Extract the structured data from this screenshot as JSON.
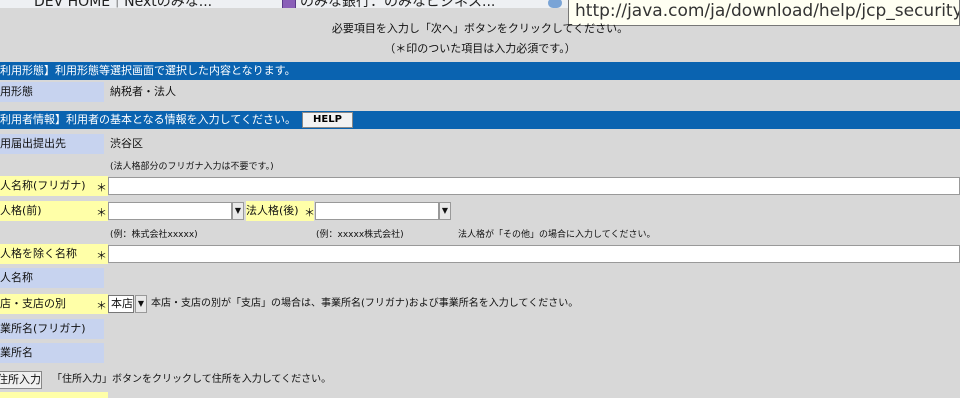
{
  "browser": {
    "tab_1": "DEV HOME｜Nextのみな...",
    "tab_2": "のみな銀行：のみなビジネス...",
    "url_tooltip": "http://java.com/ja/download/help/jcp_security.xml"
  },
  "notice": {
    "line1": "必要項目を入力し「次へ」ボタンをクリックしてください。",
    "line2": "（＊印のついた項目は入力必須です。）"
  },
  "section_usage": {
    "header": "利用形態】利用形態等選択画面で選択した内容となります。",
    "type_label": "用形態",
    "type_value": "納税者・法人"
  },
  "section_user": {
    "header": "利用者情報】利用者の基本となる情報を入力してください。",
    "help_label": "HELP",
    "office_label": "用届出提出先",
    "office_value": "渋谷区",
    "furigana_note": "(法人格部分のフリガナ入力は不要です。)",
    "corp_name_kana_label": "人名称(フリガナ)",
    "corp_type_front_label": "人格(前)",
    "corp_type_back_label": "法人格(後)",
    "required_mark": "＊",
    "example_front": "(例：株式会社xxxxx)",
    "example_back": "(例：xxxxx株式会社)",
    "other_note": "法人格が「その他」の場合に入力してください。",
    "name_excl_label": "人格を除く名称",
    "corp_name_label": "人名称",
    "branch_label": "店・支店の別",
    "branch_value": "本店",
    "branch_note": "本店・支店の別が「支店」の場合は、事業所名(フリガナ)および事業所名を入力してください。",
    "office_name_kana_label": "業所名(フリガナ)",
    "office_name_label": "業所名",
    "address_button": "住所入力",
    "address_note": "「住所入力」ボタンをクリックして住所を入力してください。"
  },
  "colors": {
    "section_bar": "#0a63b0",
    "required_label": "#ffffa8",
    "label": "#c7d3ef"
  }
}
